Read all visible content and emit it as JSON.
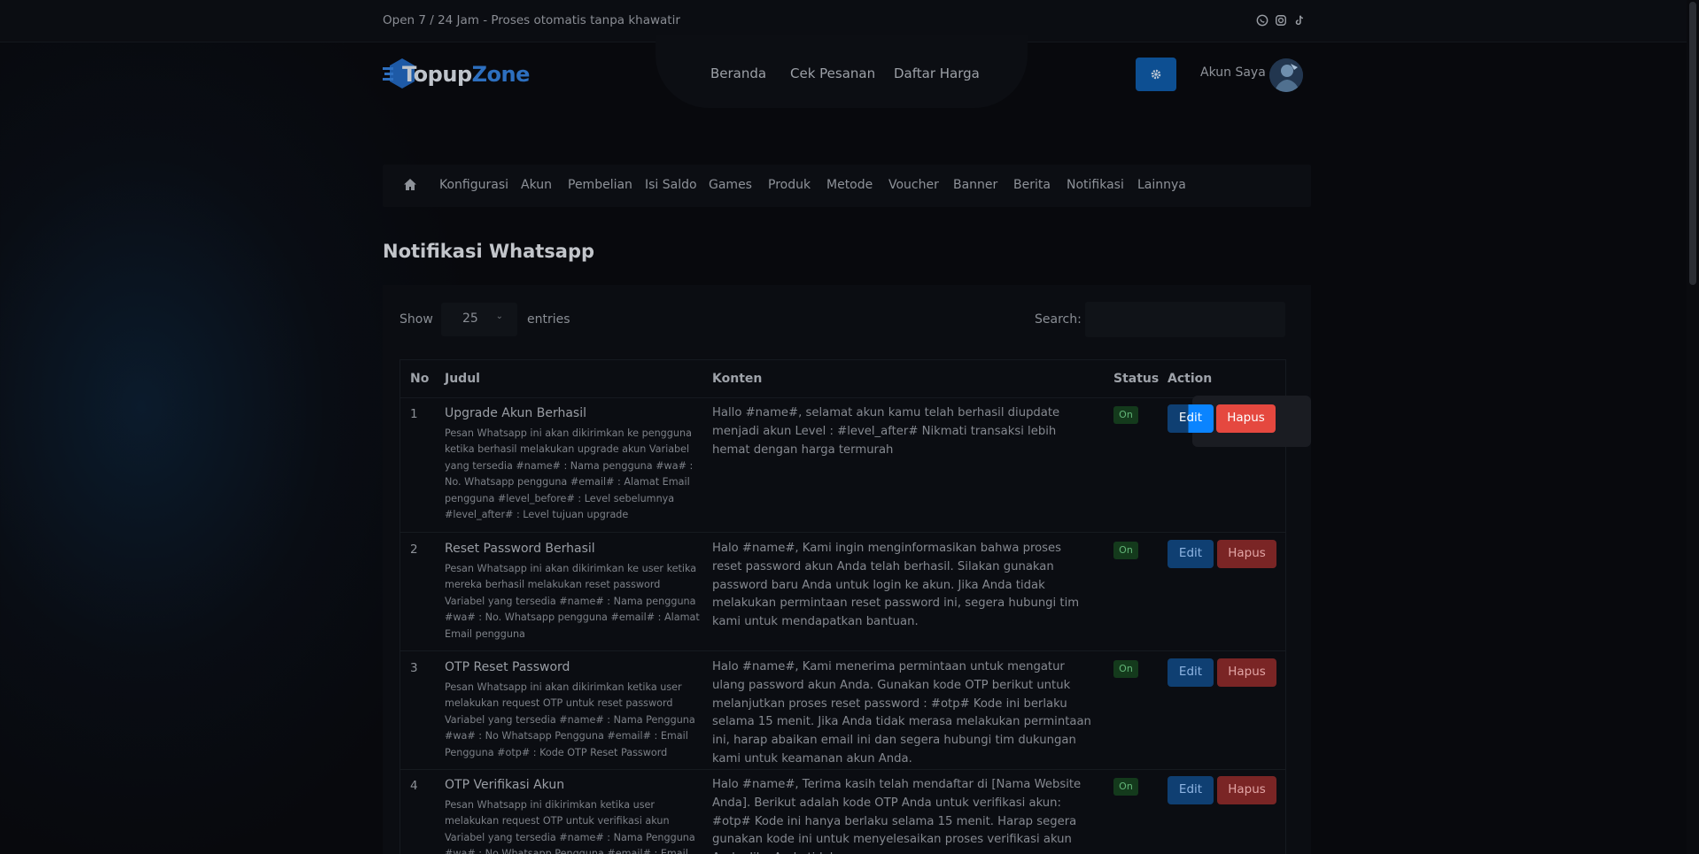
{
  "topbar": {
    "text": "Open 7 / 24 Jam - Proses otomatis tanpa khawatir",
    "socials": [
      "whatsapp-icon",
      "instagram-icon",
      "tiktok-icon"
    ]
  },
  "brand": {
    "part1": "Topup",
    "part2": "Zone"
  },
  "nav": [
    {
      "label": "Beranda"
    },
    {
      "label": "Cek Pesanan"
    },
    {
      "label": "Daftar Harga"
    }
  ],
  "account": {
    "label": "Akun Saya"
  },
  "admin_menu": [
    {
      "label": "Konfigurasi"
    },
    {
      "label": "Akun"
    },
    {
      "label": "Pembelian"
    },
    {
      "label": "Isi Saldo"
    },
    {
      "label": "Games"
    },
    {
      "label": "Produk"
    },
    {
      "label": "Metode"
    },
    {
      "label": "Voucher"
    },
    {
      "label": "Banner"
    },
    {
      "label": "Berita"
    },
    {
      "label": "Notifikasi"
    },
    {
      "label": "Lainnya"
    }
  ],
  "page": {
    "title": "Notifikasi Whatsapp"
  },
  "table_controls": {
    "show_label": "Show",
    "page_size": "25",
    "entries_label": "entries",
    "search_label": "Search:",
    "search_value": ""
  },
  "table": {
    "headers": {
      "no": "No",
      "judul": "Judul",
      "konten": "Konten",
      "status": "Status",
      "action": "Action"
    },
    "rows": [
      {
        "no": "1",
        "title": "Upgrade Akun Berhasil",
        "desc": "Pesan Whatsapp ini akan dikirimkan ke pengguna ketika berhasil melakukan upgrade akun Variabel yang tersedia #name# : Nama pengguna #wa# : No. Whatsapp pengguna #email# : Alamat Email pengguna #level_before# : Level sebelumnya #level_after# : Level tujuan upgrade",
        "konten": "Hallo #name#, selamat akun kamu telah berhasil diupdate menjadi akun Level : #level_after# Nikmati transaksi lebih hemat dengan harga termurah",
        "status": "On",
        "edit": "Edit",
        "hapus": "Hapus"
      },
      {
        "no": "2",
        "title": "Reset Password Berhasil",
        "desc": "Pesan Whatsapp ini akan dikirimkan ke user ketika mereka berhasil melakukan reset password Variabel yang tersedia #name# : Nama pengguna #wa# : No. Whatsapp pengguna #email# : Alamat Email pengguna",
        "konten": "Halo #name#, Kami ingin menginformasikan bahwa proses reset password akun Anda telah berhasil. Silakan gunakan password baru Anda untuk login ke akun. Jika Anda tidak melakukan permintaan reset password ini, segera hubungi tim kami untuk mendapatkan bantuan.",
        "status": "On",
        "edit": "Edit",
        "hapus": "Hapus"
      },
      {
        "no": "3",
        "title": "OTP Reset Password",
        "desc": "Pesan Whatsapp ini akan dikirimkan ketika user melakukan request OTP untuk reset password Variabel yang tersedia #name# : Nama Pengguna #wa# : No Whatsapp Pengguna #email# : Email Pengguna #otp# : Kode OTP Reset Password",
        "konten": "Halo #name#, Kami menerima permintaan untuk mengatur ulang password akun Anda. Gunakan kode OTP berikut untuk melanjutkan proses reset password : #otp# Kode ini berlaku selama 15 menit. Jika Anda tidak merasa melakukan permintaan ini, harap abaikan email ini dan segera hubungi tim dukungan kami untuk keamanan akun Anda.",
        "status": "On",
        "edit": "Edit",
        "hapus": "Hapus"
      },
      {
        "no": "4",
        "title": "OTP Verifikasi Akun",
        "desc": "Pesan Whatsapp ini dikirimkan ketika user melakukan request OTP untuk verifikasi akun Variabel yang tersedia #name# : Nama Pengguna #wa# : No Whatsapp Pengguna #email# : Email",
        "konten": "Halo #name#, Terima kasih telah mendaftar di [Nama Website Anda]. Berikut adalah kode OTP  Anda untuk verifikasi akun: #otp# Kode ini hanya berlaku selama 15 menit. Harap segera gunakan kode ini untuk menyelesaikan proses verifikasi akun Anda. Jika Anda tidak merasa",
        "status": "On",
        "edit": "Edit",
        "hapus": "Hapus"
      }
    ]
  },
  "colors": {
    "background": "#08090d",
    "accent_blue": "#0d4f92",
    "hapus_red": "#e5483f",
    "status_green": "#62b577"
  }
}
